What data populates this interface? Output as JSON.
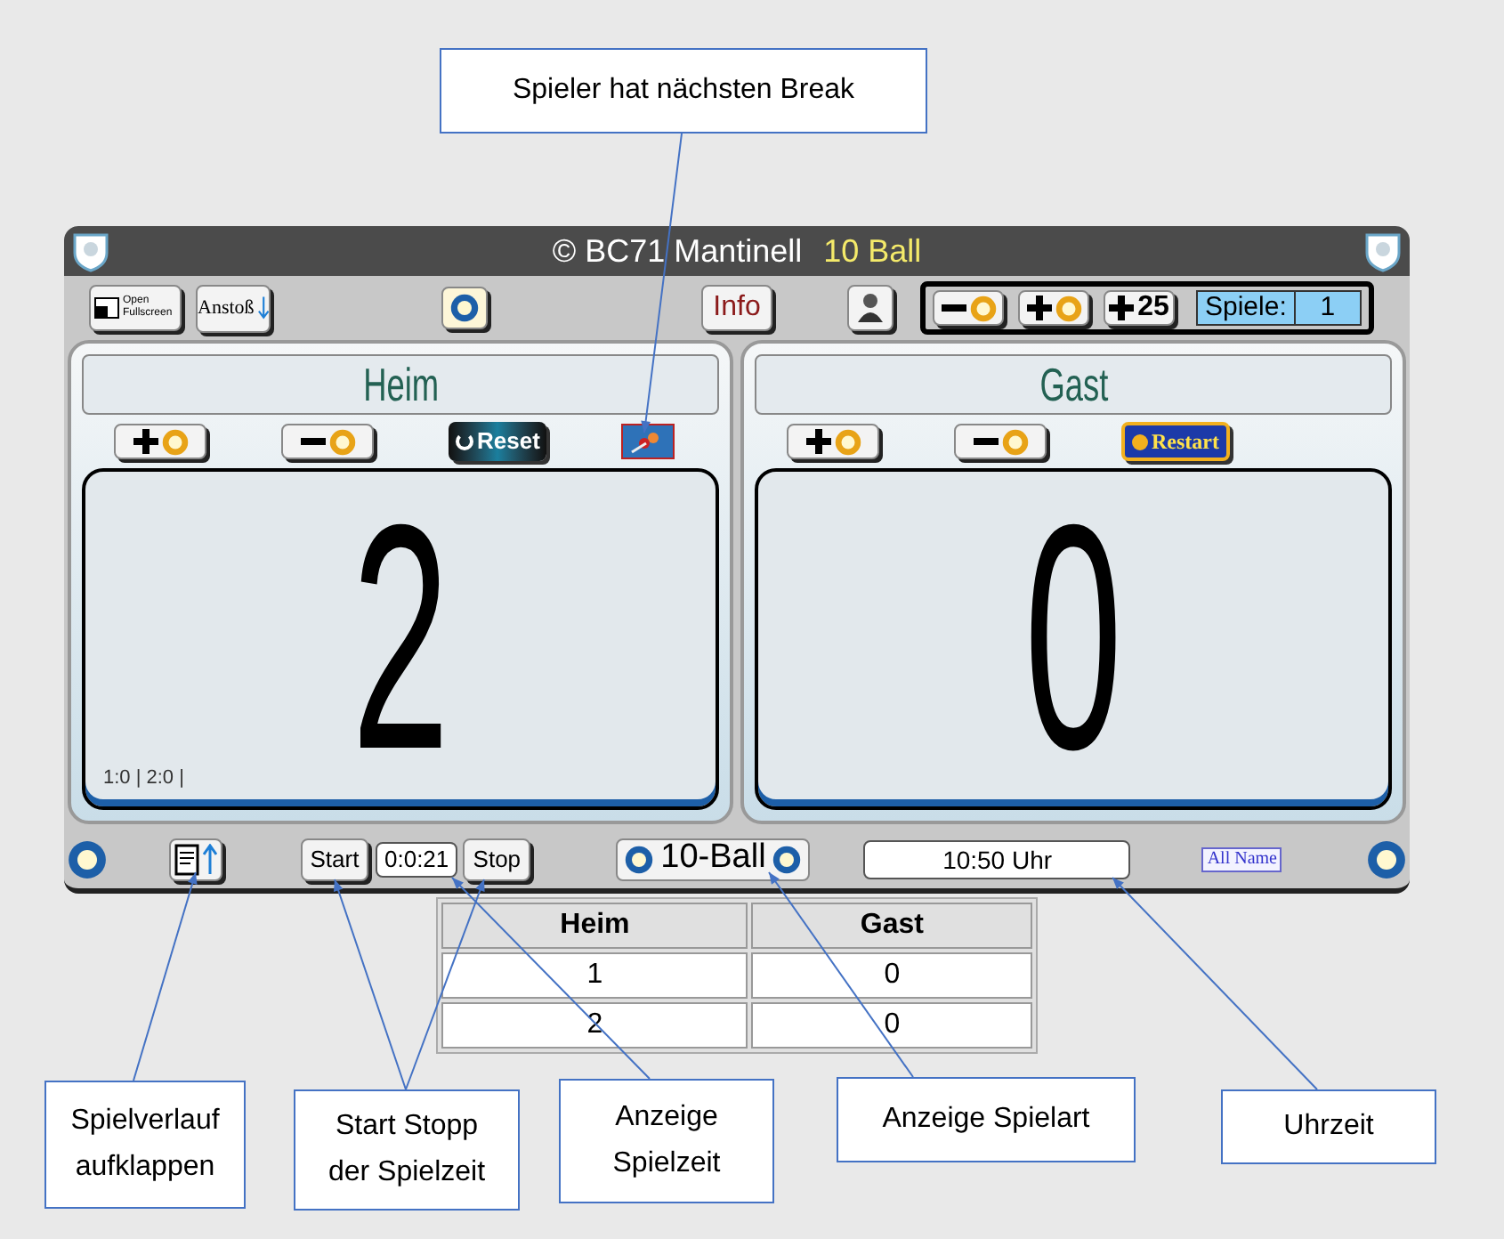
{
  "title_bar": {
    "copyright": "© BC71 Mantinell",
    "game": "10 Ball"
  },
  "toolbar": {
    "fullscreen_lines": [
      "Open",
      "Fullscreen"
    ],
    "break_button": "Anstoß",
    "info_button": "Info",
    "bonus_value": "25",
    "games_label": "Spiele:",
    "games_value": "1"
  },
  "players": [
    {
      "name": "Heim",
      "score": "2",
      "history": "1:0 | 2:0 |",
      "action": {
        "kind": "reset",
        "label": "Reset"
      },
      "has_break": true
    },
    {
      "name": "Gast",
      "score": "0",
      "action": {
        "kind": "restart",
        "label": "Restart"
      },
      "has_break": false
    }
  ],
  "bottom_bar": {
    "start": "Start",
    "timer": "0:0:21",
    "stop": "Stop",
    "game_type": "10-Ball",
    "clock": "10:50 Uhr",
    "names_button": "All Name"
  },
  "table": {
    "columns": [
      "Heim",
      "Gast"
    ],
    "rows": [
      [
        "1",
        "0"
      ],
      [
        "2",
        "0"
      ]
    ]
  },
  "callouts": [
    {
      "text": "Spieler hat nächsten Break"
    },
    {
      "text": "Spielverlauf\naufklappen"
    },
    {
      "text": "Start Stopp\nder Spielzeit"
    },
    {
      "text": "Anzeige\nSpielzeit"
    },
    {
      "text": "Anzeige Spielart"
    },
    {
      "text": "Uhrzeit"
    }
  ]
}
